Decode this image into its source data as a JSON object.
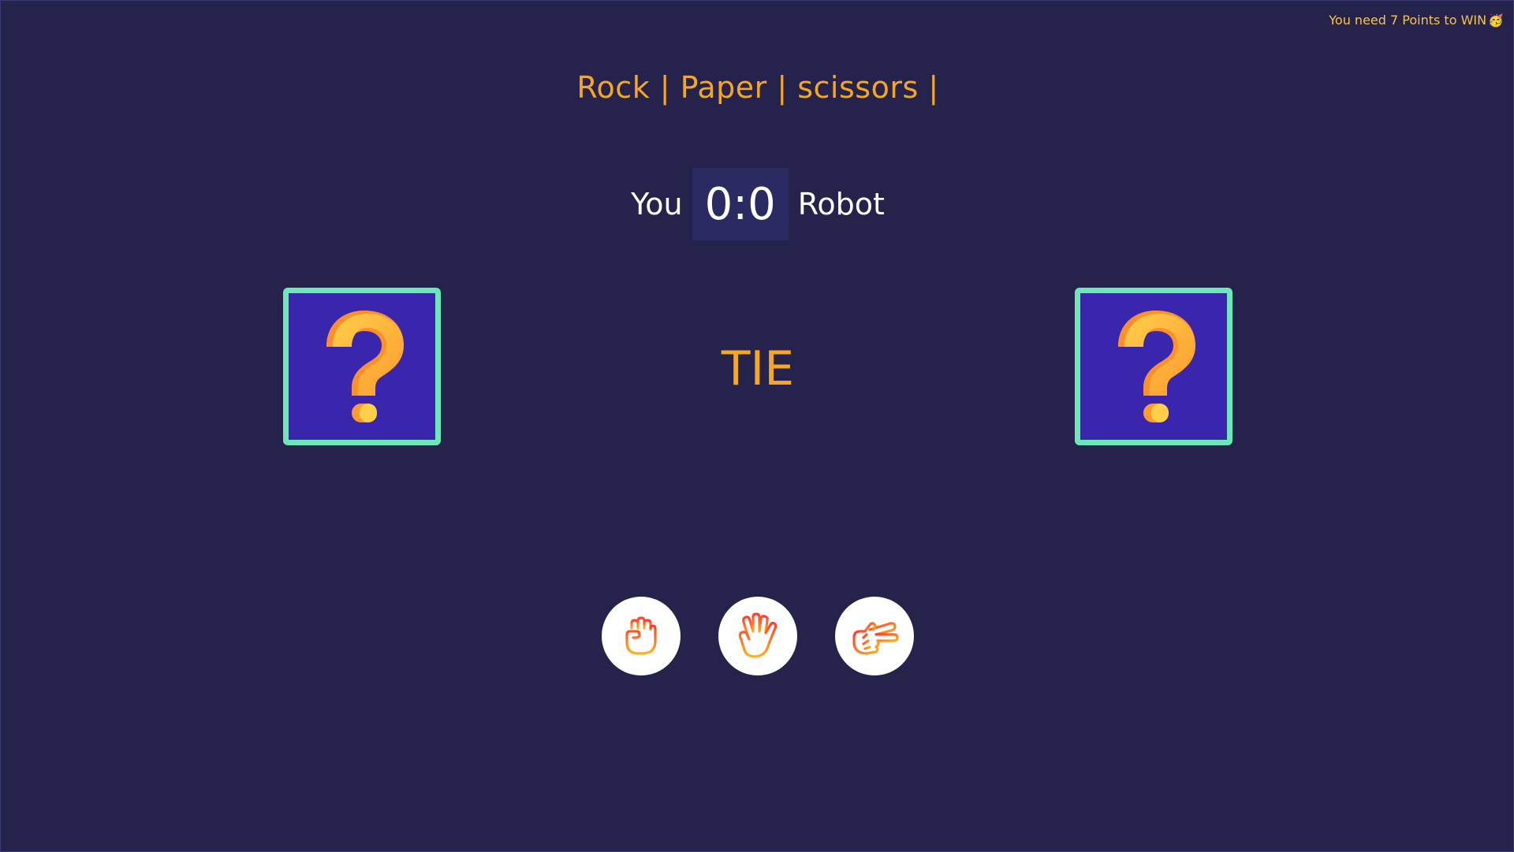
{
  "goal_note": {
    "text": "You need 7 Points to WIN",
    "icon": "party-face-icon"
  },
  "title": "Rock | Paper | scissors |",
  "scoreboard": {
    "player_label": "You",
    "score": "0:0",
    "opponent_label": "Robot"
  },
  "player_choice": {
    "icon": "question-mark-icon"
  },
  "robot_choice": {
    "icon": "question-mark-icon"
  },
  "result": "TIE",
  "moves": [
    {
      "name": "rock",
      "icon": "fist-icon"
    },
    {
      "name": "paper",
      "icon": "open-hand-icon"
    },
    {
      "name": "scissors",
      "icon": "scissors-hand-icon"
    }
  ],
  "colors": {
    "background": "#25234b",
    "accent": "#f5a623",
    "card_fill": "#3a26ad",
    "card_border": "#6ee7b7",
    "score_box": "#2c2a63"
  }
}
